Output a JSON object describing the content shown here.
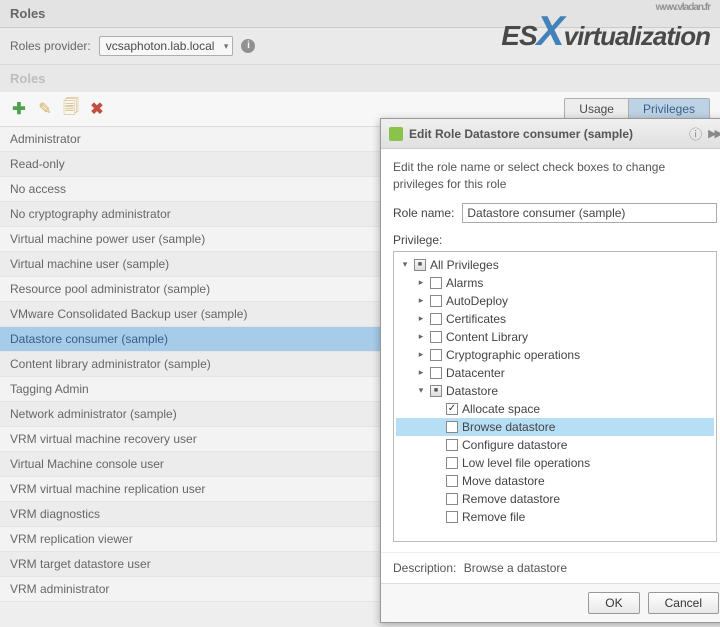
{
  "header": {
    "title": "Roles"
  },
  "provider": {
    "label": "Roles provider:",
    "value": "vcsaphoton.lab.local"
  },
  "section_label": "Roles",
  "tabs": {
    "usage": "Usage",
    "privileges": "Privileges",
    "selected": "privileges"
  },
  "roles": [
    "Administrator",
    "Read-only",
    "No access",
    "No cryptography administrator",
    "Virtual machine power user (sample)",
    "Virtual machine user (sample)",
    "Resource pool administrator (sample)",
    "VMware Consolidated Backup user (sample)",
    "Datastore consumer (sample)",
    "Content library administrator (sample)",
    "Tagging Admin",
    "Network administrator (sample)",
    "VRM virtual machine recovery user",
    "Virtual Machine console user",
    "VRM virtual machine replication user",
    "VRM diagnostics",
    "VRM replication viewer",
    "VRM target datastore user",
    "VRM administrator"
  ],
  "selected_role_index": 8,
  "modal": {
    "title": "Edit Role Datastore consumer (sample)",
    "instruction": "Edit the role name or select check boxes to change privileges for this role",
    "role_name_label": "Role name:",
    "role_name_value": "Datastore consumer (sample)",
    "privilege_label": "Privilege:",
    "tree": {
      "root": "All Privileges",
      "children": [
        "Alarms",
        "AutoDeploy",
        "Certificates",
        "Content Library",
        "Cryptographic operations",
        "Datacenter"
      ],
      "datastore_label": "Datastore",
      "datastore_children": [
        {
          "label": "Allocate space",
          "checked": true,
          "hl": false
        },
        {
          "label": "Browse datastore",
          "checked": false,
          "hl": true
        },
        {
          "label": "Configure datastore",
          "checked": false,
          "hl": false
        },
        {
          "label": "Low level file operations",
          "checked": false,
          "hl": false
        },
        {
          "label": "Move datastore",
          "checked": false,
          "hl": false
        },
        {
          "label": "Remove datastore",
          "checked": false,
          "hl": false
        },
        {
          "label": "Remove file",
          "checked": false,
          "hl": false
        }
      ]
    },
    "description_label": "Description:",
    "description_value": "Browse a datastore",
    "ok": "OK",
    "cancel": "Cancel"
  },
  "watermark": {
    "url": "www.vladan.fr",
    "prefix": "ES",
    "x": "X",
    "suffix": "virtualization"
  }
}
